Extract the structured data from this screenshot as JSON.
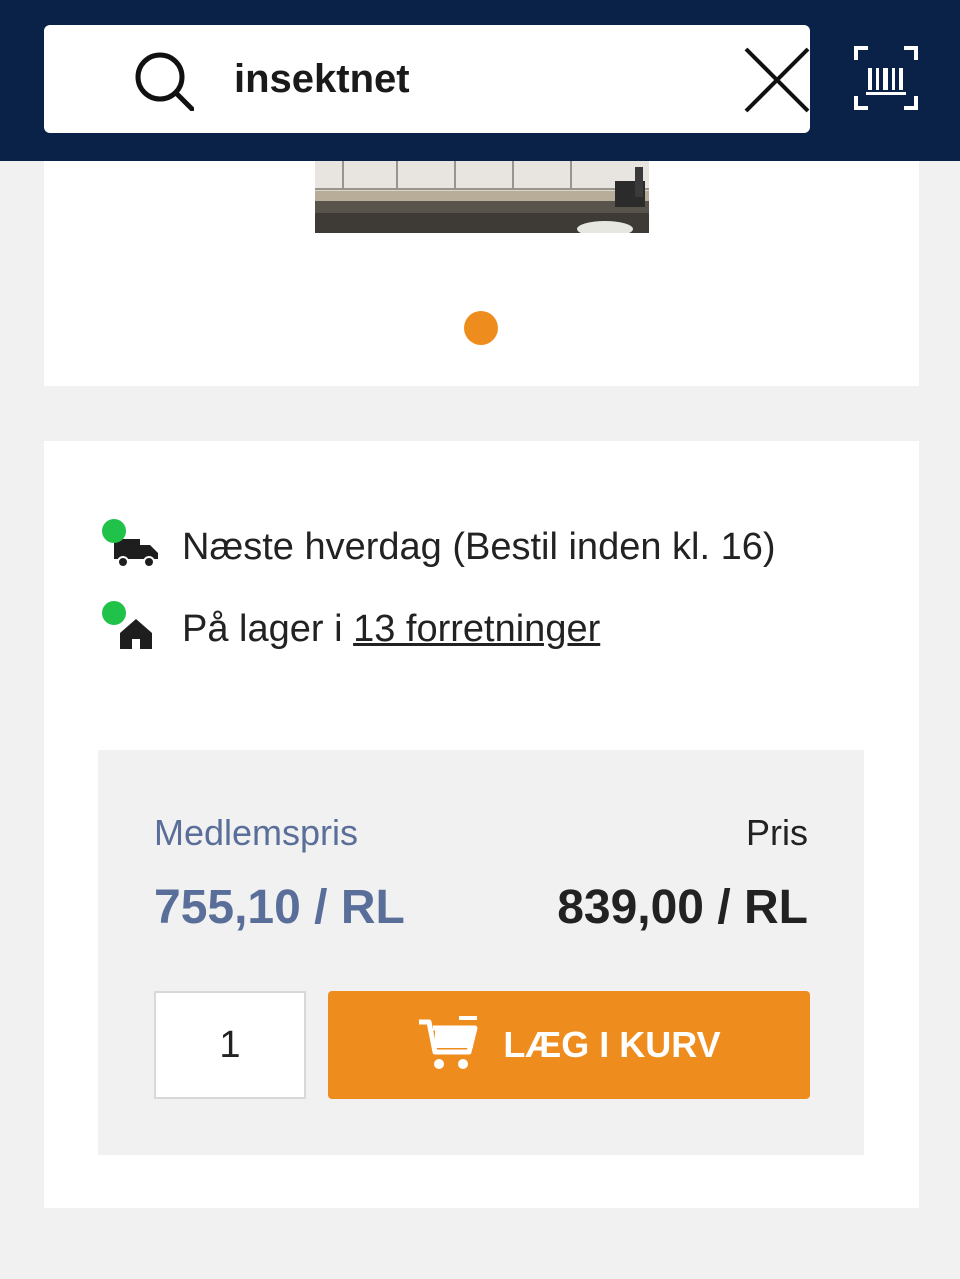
{
  "search": {
    "value": "insektnet",
    "search_icon": "search-icon",
    "clear_icon": "close-icon",
    "scan_icon": "barcode-scan-icon"
  },
  "gallery": {
    "image": "product-image",
    "active_dot_color": "#ef8c1e",
    "pages": 1,
    "current_page": 1
  },
  "availability": {
    "delivery": {
      "icon": "delivery-truck-icon",
      "status_color": "#21c24a",
      "text": "Næste hverdag (Bestil inden kl. 16)"
    },
    "stock": {
      "icon": "store-home-icon",
      "status_color": "#21c24a",
      "prefix": "På lager i ",
      "link_text": "13 forretninger"
    }
  },
  "pricing": {
    "member_label": "Medlemspris",
    "member_value": "755,10 / RL",
    "price_label": "Pris",
    "price_value": "839,00 / RL"
  },
  "cart": {
    "quantity": "1",
    "button_label": "LÆG I KURV",
    "button_icon": "cart-icon",
    "accent": "#ef8c1e"
  },
  "colors": {
    "header_bg": "#0b2248",
    "member_price": "#5a6e9a"
  }
}
